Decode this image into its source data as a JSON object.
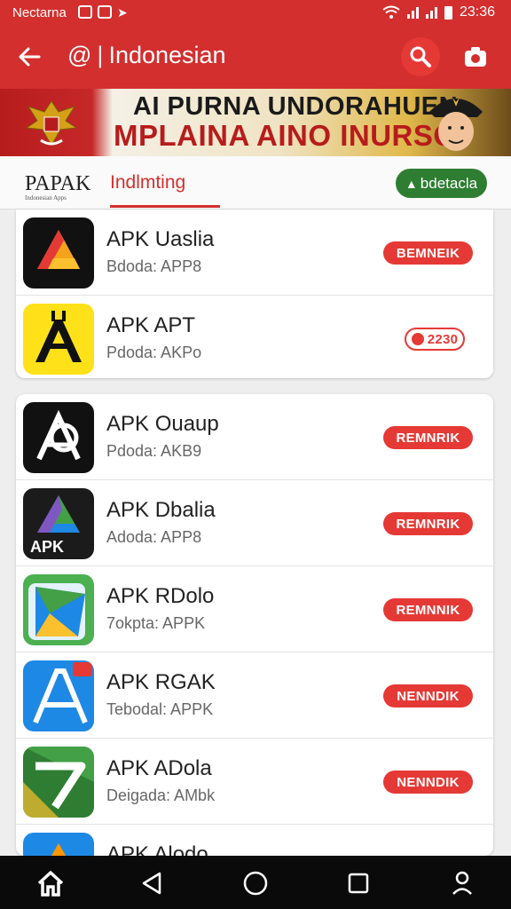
{
  "statusbar": {
    "carrier": "Nectarna",
    "time": "23:36"
  },
  "appbar": {
    "at_symbol": "@",
    "title": "Indonesian"
  },
  "banner": {
    "line1": "AI PURNA UNDORAHUEN",
    "line2": "MPLAINA AINO INURSO"
  },
  "tabs": {
    "logo": "PAPAK",
    "logo_sub": "Indonesian Apps",
    "active": "Indlmting",
    "chip": "bdetacla"
  },
  "colors": {
    "accent": "#d32f2f",
    "chip": "#2e7d32",
    "navbar": "#0a0a0a"
  },
  "list1": [
    {
      "name": "APK Uaslia",
      "sub": "Bdoda: APP8",
      "action": "BEMNEIK",
      "icon": "drive-triangle-icon"
    },
    {
      "name": "APK APT",
      "sub": "Pdoda: AKPo",
      "action": "2230",
      "icon": "yellow-tool-icon"
    }
  ],
  "list2": [
    {
      "name": "APK Ouaup",
      "sub": "Pdoda: AKB9",
      "action": "REMNRIK",
      "icon": "black-a-logo-icon"
    },
    {
      "name": "APK Dbalia",
      "sub": "Adoda: APP8",
      "action": "REMNRIK",
      "icon": "apk-triangle-icon"
    },
    {
      "name": "APK RDolo",
      "sub": "7okpta: APPK",
      "action": "REMNNIK",
      "icon": "play-triangle-icon"
    },
    {
      "name": "APK RGAK",
      "sub": "Tebodal: APPK",
      "action": "NENNDIK",
      "icon": "blue-a-logo-icon"
    },
    {
      "name": "APK ADola",
      "sub": "Deigada: AMbk",
      "action": "NENNDIK",
      "icon": "green-seven-icon"
    },
    {
      "name": "APK Alodo",
      "sub": "",
      "action": "",
      "icon": "orange-triangle-icon"
    }
  ],
  "navbar": {
    "profile_label": "Profile"
  }
}
